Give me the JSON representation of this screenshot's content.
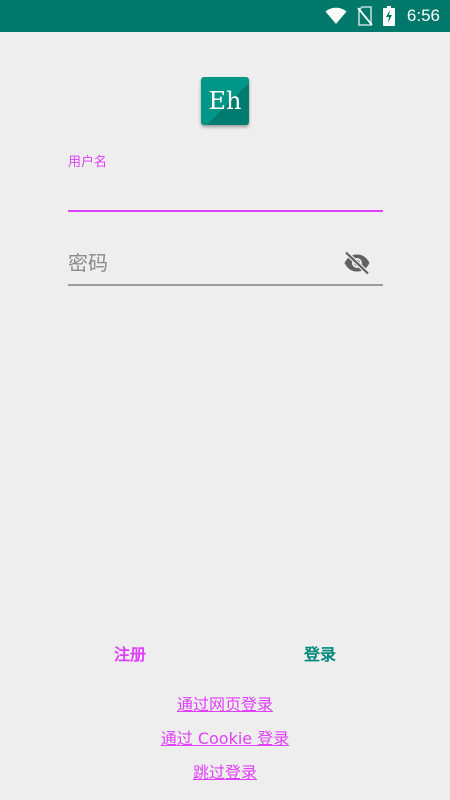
{
  "status_bar": {
    "time": "6:56",
    "icons": [
      "wifi-icon",
      "no-sim-icon",
      "battery-charging-icon"
    ]
  },
  "logo": {
    "text": "Eh"
  },
  "username": {
    "label": "用户名",
    "value": ""
  },
  "password": {
    "placeholder": "密码",
    "value": "",
    "toggle_icon": "visibility-off-icon"
  },
  "actions": {
    "register_label": "注册",
    "login_label": "登录"
  },
  "links": {
    "web_login": "通过网页登录",
    "cookie_login": "通过 Cookie 登录",
    "skip_login": "跳过登录"
  },
  "colors": {
    "status_bar": "#00796b",
    "background": "#eeeeee",
    "accent": "#e040fb",
    "primary": "#009688",
    "login_button": "#00897b"
  }
}
